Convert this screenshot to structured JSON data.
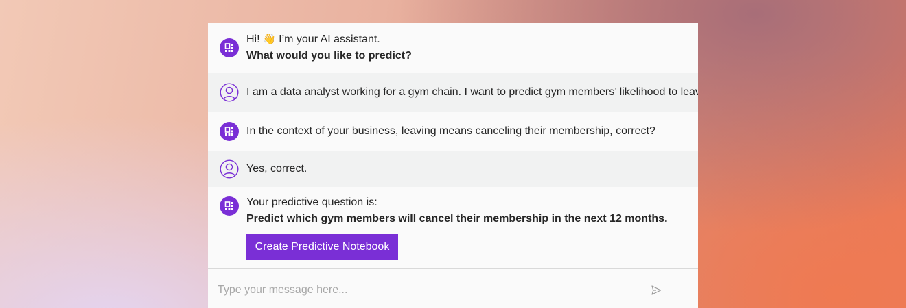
{
  "chat": {
    "messages": [
      {
        "role": "assistant",
        "line1_prefix": "Hi! ",
        "emoji": "👋",
        "line1_suffix": " I’m your AI assistant.",
        "line2": "What would you like to predict?"
      },
      {
        "role": "user",
        "text": "I am a data analyst working for a gym chain. I want to predict gym members’ likelihood to leave."
      },
      {
        "role": "assistant",
        "text": "In the context of your business, leaving means canceling their membership, correct?"
      },
      {
        "role": "user",
        "text": "Yes, correct."
      },
      {
        "role": "assistant",
        "line1": "Your predictive question is:",
        "line2": "Predict which gym members will cancel their membership in the next 12 months."
      }
    ],
    "cta_button": "Create Predictive Notebook"
  },
  "input": {
    "placeholder": "Type your message here...",
    "value": ""
  },
  "icons": {
    "assistant_avatar": "bot-avatar-icon",
    "user_avatar": "user-avatar-icon",
    "send": "send-icon"
  },
  "colors": {
    "accent": "#7a2fd6",
    "user_row_bg": "#f1f2f2",
    "panel_bg": "#fafafa",
    "text": "#262626",
    "placeholder": "#a8a8a8"
  }
}
